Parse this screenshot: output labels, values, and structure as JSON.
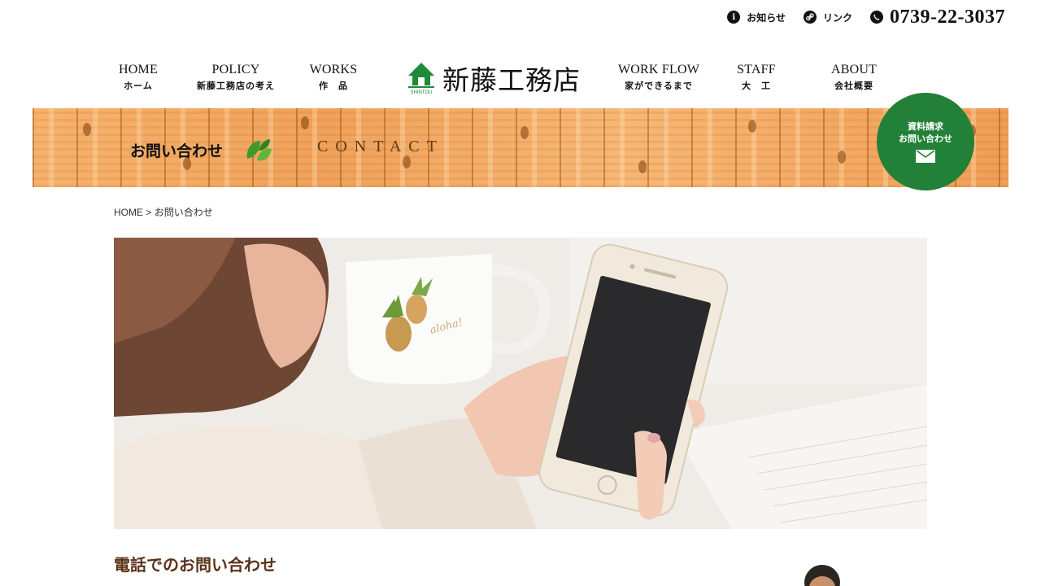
{
  "utility": {
    "news_label": "お知らせ",
    "link_label": "リンク",
    "phone": "0739-22-3037"
  },
  "nav": {
    "home": {
      "en": "HOME",
      "jp": "ホーム"
    },
    "policy": {
      "en": "POLICY",
      "jp": "新藤工務店の考え"
    },
    "works": {
      "en": "WORKS",
      "jp": "作　品"
    },
    "workflow": {
      "en": "WORK FLOW",
      "jp": "家ができるまで"
    },
    "staff": {
      "en": "STAFF",
      "jp": "大　工"
    },
    "about": {
      "en": "ABOUT",
      "jp": "会社概要"
    }
  },
  "logo": {
    "name": "新藤工務店",
    "sub": "SHINTOU"
  },
  "banner": {
    "title": "お問い合わせ",
    "subtitle": "CONTACT"
  },
  "contact_button": {
    "line1": "資料請求",
    "line2": "お問い合わせ"
  },
  "breadcrumb": {
    "home": "HOME",
    "separator": " > ",
    "current": "お問い合わせ"
  },
  "hero": {
    "mug_text": "aloha!"
  },
  "section": {
    "phone_title": "電話でのお問い合わせ"
  },
  "colors": {
    "brand_green": "#238038",
    "title_brown": "#5a3218"
  },
  "icons": {
    "news": "info-icon",
    "link": "link-icon",
    "phone": "phone-icon",
    "mail": "mail-icon",
    "leaf": "leaf-icon"
  }
}
